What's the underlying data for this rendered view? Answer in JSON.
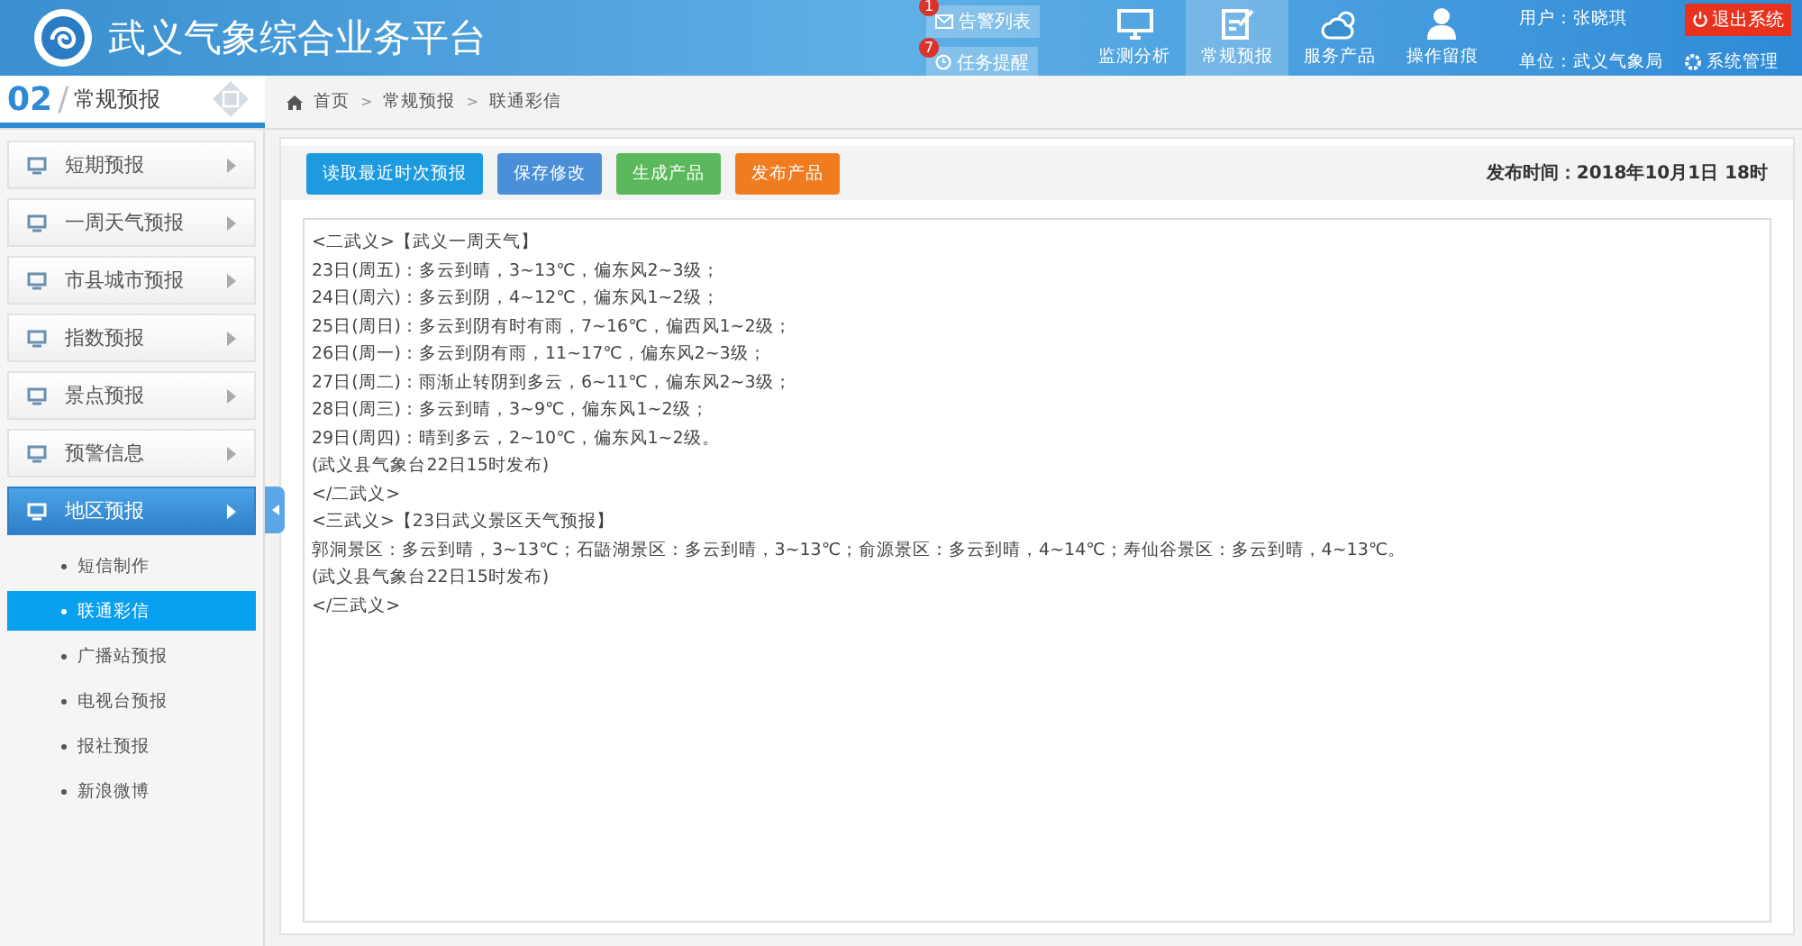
{
  "header": {
    "title": "武义气象综合业务平台",
    "alerts": [
      {
        "label": "告警列表",
        "count": "1",
        "kind": "mail"
      },
      {
        "label": "任务提醒",
        "count": "7",
        "kind": "clock"
      }
    ],
    "nav": [
      {
        "label": "监测分析",
        "kind": "monitor",
        "selected": false
      },
      {
        "label": "常规预报",
        "kind": "edit",
        "selected": true
      },
      {
        "label": "服务产品",
        "kind": "weather",
        "selected": false
      },
      {
        "label": "操作留痕",
        "kind": "user",
        "selected": false
      }
    ],
    "user": "用户：张晓琪",
    "unit": "单位：武义气象局",
    "logout": "退出系统",
    "settings": "系统管理"
  },
  "section": {
    "number": "02",
    "separator": "/",
    "title": "常规预报"
  },
  "breadcrumb": [
    {
      "kind": "link",
      "label": "首页"
    },
    {
      "kind": "separator",
      "label": ">"
    },
    {
      "kind": "link",
      "label": "常规预报"
    },
    {
      "kind": "separator",
      "label": ">"
    },
    {
      "kind": "link",
      "label": "联通彩信"
    }
  ],
  "sidebar": [
    {
      "label": "短期预报",
      "selected": false
    },
    {
      "label": "一周天气预报",
      "selected": false
    },
    {
      "label": "市县城市预报",
      "selected": false
    },
    {
      "label": "指数预报",
      "selected": false
    },
    {
      "label": "景点预报",
      "selected": false
    },
    {
      "label": "预警信息",
      "selected": false
    },
    {
      "label": "地区预报",
      "selected": true,
      "children": [
        {
          "label": "短信制作",
          "selected": false
        },
        {
          "label": "联通彩信",
          "selected": true
        },
        {
          "label": "广播站预报",
          "selected": false
        },
        {
          "label": "电视台预报",
          "selected": false
        },
        {
          "label": "报社预报",
          "selected": false
        },
        {
          "label": "新浪微博",
          "selected": false
        }
      ]
    }
  ],
  "toolbar": {
    "buttons": [
      {
        "label": "读取最近时次预报",
        "color": "#1e9be0"
      },
      {
        "label": "保存修改",
        "color": "#4a8fd8"
      },
      {
        "label": "生成产品",
        "color": "#5cb85c"
      },
      {
        "label": "发布产品",
        "color": "#f07c1f"
      }
    ],
    "publish_time": "发布时间：2018年10月1日 18时"
  },
  "editor": {
    "lines": [
      "<二武义>【武义一周天气】",
      "23日(周五)：多云到晴，3~13℃，偏东风2~3级；",
      "24日(周六)：多云到阴，4~12℃，偏东风1~2级；",
      "25日(周日)：多云到阴有时有雨，7~16℃，偏西风1~2级；",
      "26日(周一)：多云到阴有雨，11~17℃，偏东风2~3级；",
      "27日(周二)：雨渐止转阴到多云，6~11℃，偏东风2~3级；",
      "28日(周三)：多云到晴，3~9℃，偏东风1~2级；",
      "29日(周四)：晴到多云，2~10℃，偏东风1~2级。",
      "(武义县气象台22日15时发布)",
      "</二武义>",
      "<三武义>【23日武义景区天气预报】",
      "郭洞景区：多云到晴，3~13℃；石鼯湖景区：多云到晴，3~13℃；俞源景区：多云到晴，4~14℃；寿仙谷景区：多云到晴，4~13℃。",
      "(武义县气象台22日15时发布)",
      "</三武义>"
    ]
  }
}
